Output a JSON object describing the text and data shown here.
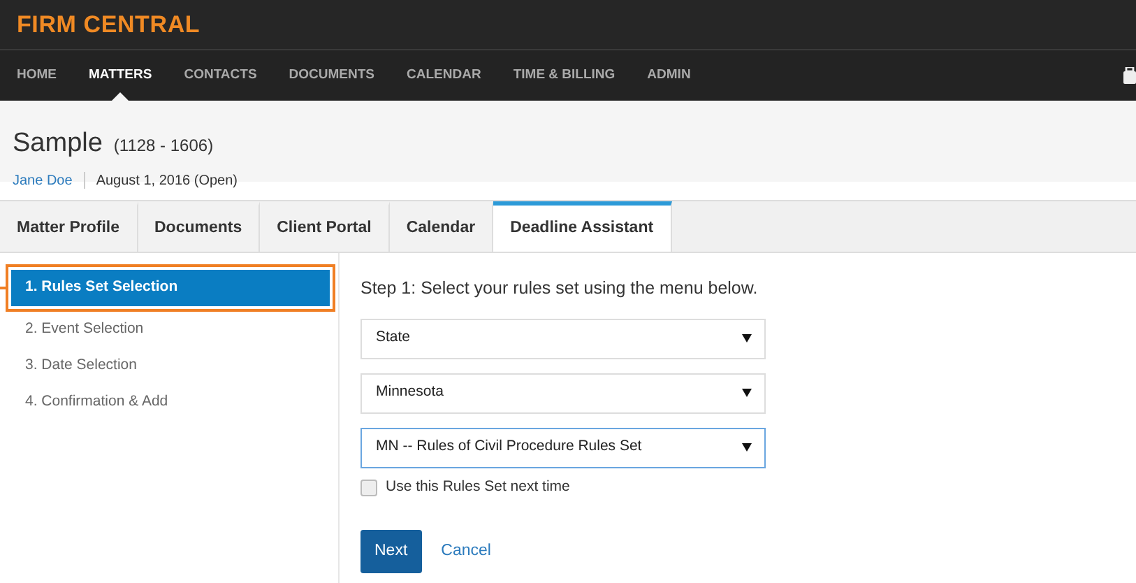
{
  "app": {
    "logo": "FIRM CENTRAL"
  },
  "nav": [
    {
      "label": "HOME",
      "selected": false
    },
    {
      "label": "MATTERS",
      "selected": true
    },
    {
      "label": "CONTACTS",
      "selected": false
    },
    {
      "label": "DOCUMENTS",
      "selected": false
    },
    {
      "label": "CALENDAR",
      "selected": false
    },
    {
      "label": "TIME & BILLING",
      "selected": false
    },
    {
      "label": "ADMIN",
      "selected": false
    }
  ],
  "matter": {
    "title": "Sample",
    "number": "(1128 - 1606)",
    "client": "Jane Doe",
    "date": "August 1, 2016 (Open)"
  },
  "tabs": [
    {
      "label": "Matter Profile",
      "selected": false
    },
    {
      "label": "Documents",
      "selected": false
    },
    {
      "label": "Client Portal",
      "selected": false
    },
    {
      "label": "Calendar",
      "selected": false
    },
    {
      "label": "Deadline Assistant",
      "selected": true
    }
  ],
  "steps": [
    {
      "label": "1. Rules Set Selection",
      "selected": true
    },
    {
      "label": "2. Event Selection",
      "selected": false
    },
    {
      "label": "3. Date Selection",
      "selected": false
    },
    {
      "label": "4. Confirmation & Add",
      "selected": false
    }
  ],
  "form": {
    "heading": "Step 1: Select your rules set using the menu below.",
    "selects": [
      {
        "value": "State",
        "focused": false
      },
      {
        "value": "Minnesota",
        "focused": false
      },
      {
        "value": "MN -- Rules of Civil Procedure Rules Set",
        "focused": true
      }
    ],
    "checkbox": {
      "label": "Use this Rules Set next time",
      "checked": false
    },
    "buttons": [
      {
        "label": "Next",
        "kind": "primary"
      },
      {
        "label": "Cancel",
        "kind": "link"
      }
    ]
  }
}
